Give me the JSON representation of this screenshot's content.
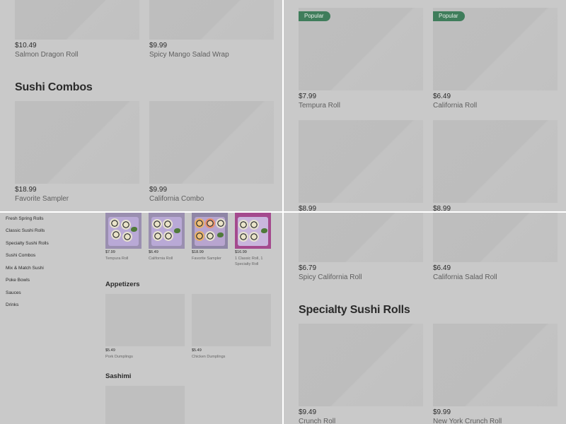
{
  "top_left": {
    "cards_top": [
      {
        "price": "$10.49",
        "name": "Salmon Dragon Roll"
      },
      {
        "price": "$9.99",
        "name": "Spicy Mango Salad Wrap"
      }
    ],
    "section_title": "Sushi Combos",
    "cards": [
      {
        "price": "$18.99",
        "name": "Favorite Sampler"
      },
      {
        "price": "$9.99",
        "name": "California Combo"
      }
    ]
  },
  "top_right": {
    "cards": [
      {
        "badge": "Popular",
        "price": "$7.99",
        "name": "Tempura Roll"
      },
      {
        "badge": "Popular",
        "price": "$6.49",
        "name": "California Roll"
      }
    ],
    "cards_row2": [
      {
        "price": "$8.99"
      },
      {
        "price": "$8.99"
      }
    ]
  },
  "bottom_left": {
    "sidebar": [
      "Fresh Spring Rolls",
      "Classic Sushi Rolls",
      "Specialty Sushi Rolls",
      "Sushi Combos",
      "Mix & Match Sushi",
      "Poke Bowls",
      "Sauces",
      "Drinks"
    ],
    "popular_cards": [
      {
        "price": "$7.99",
        "name": "Tempura Roll"
      },
      {
        "price": "$6.49",
        "name": "California Roll"
      },
      {
        "price": "$18.99",
        "name": "Favorite Sampler"
      },
      {
        "price": "$16.99",
        "name": "1 Classic Roll, 1 Specialty Roll"
      }
    ],
    "appetizers_title": "Appetizers",
    "appetizers": [
      {
        "price": "$5.49",
        "name": "Pork Dumplings"
      },
      {
        "price": "$5.49",
        "name": "Chicken Dumplings"
      }
    ],
    "sashimi_title": "Sashimi"
  },
  "bottom_right": {
    "cards_top": [
      {
        "price": "$6.79",
        "name": "Spicy California Roll"
      },
      {
        "price": "$6.49",
        "name": "California Salad Roll"
      }
    ],
    "section_title": "Specialty Sushi Rolls",
    "cards": [
      {
        "price": "$9.49",
        "name": "Crunch Roll"
      },
      {
        "price": "$9.99",
        "name": "New York Crunch Roll"
      }
    ]
  }
}
